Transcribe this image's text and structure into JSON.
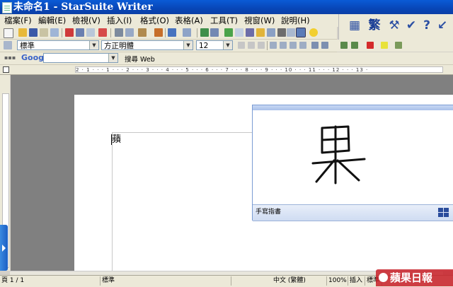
{
  "window": {
    "title": "未命名1 - StarSuite Writer"
  },
  "menu": [
    "檔案(F)",
    "編輯(E)",
    "檢視(V)",
    "插入(I)",
    "格式(O)",
    "表格(A)",
    "工具(T)",
    "視窗(W)",
    "說明(H)"
  ],
  "formatting": {
    "style": "標準",
    "font": "方正明體",
    "size": "12"
  },
  "google_bar": {
    "logo": "Google",
    "search_value": "",
    "search_button": "搜尋 Web"
  },
  "big_toolbar": {
    "traditional_label": "繁"
  },
  "document": {
    "typed_char": "蘋"
  },
  "handwriting": {
    "recognized": "果",
    "panel_label": "手寫指書"
  },
  "status": {
    "page": "頁 1 / 1",
    "style": "標準",
    "language": "中文 (繁體)",
    "zoom": "100%",
    "mode": "插入",
    "selection": "標準"
  },
  "watermark": {
    "text": "蘋果日報"
  },
  "ruler": {
    "marks": "2 · 1 · · · 1 · · · 2 · · · 3 · · · 4 · · · 5 · · · 6 · · · 7 · · · 8 · · · 9 · · · 10 · · · 11 · · · 12 · · · 13 ·"
  }
}
